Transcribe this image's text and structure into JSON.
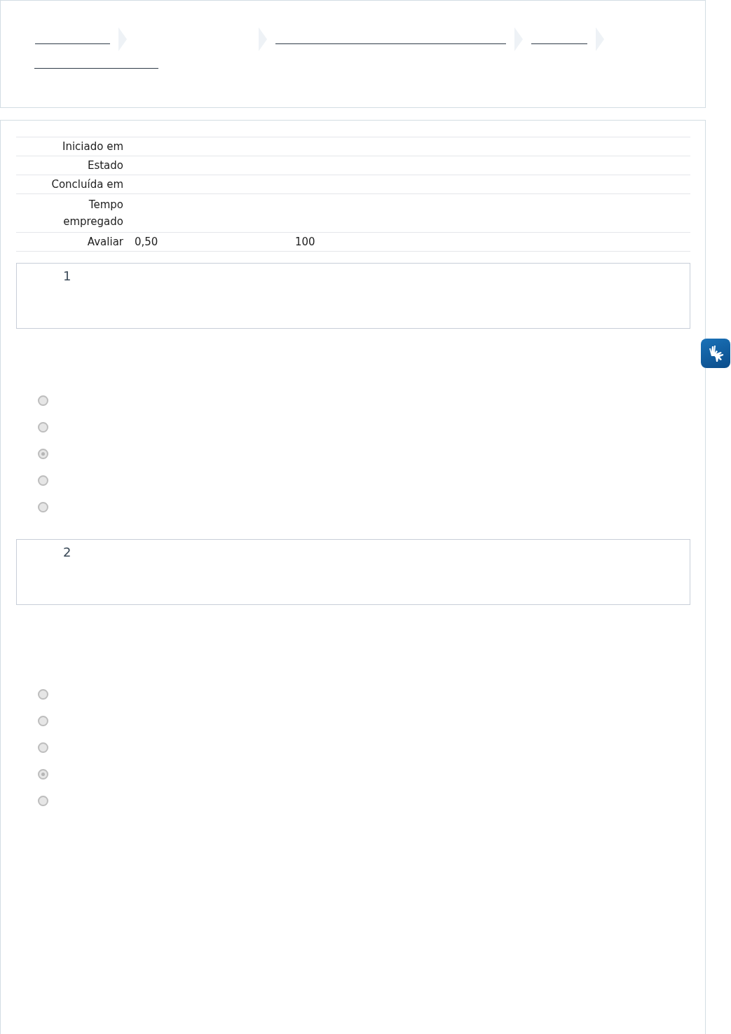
{
  "summary": {
    "rows": [
      {
        "label": "Iniciado em",
        "values": []
      },
      {
        "label": "Estado",
        "values": []
      },
      {
        "label": "Concluída em",
        "values": []
      },
      {
        "label": "Tempo empregado",
        "values": []
      },
      {
        "label": "Avaliar",
        "values": [
          "0,50",
          "100"
        ]
      }
    ]
  },
  "questions": [
    {
      "number": "1",
      "options": [
        {
          "selected": false
        },
        {
          "selected": false
        },
        {
          "selected": true
        },
        {
          "selected": false
        },
        {
          "selected": false
        }
      ]
    },
    {
      "number": "2",
      "options": [
        {
          "selected": false
        },
        {
          "selected": false
        },
        {
          "selected": false
        },
        {
          "selected": true
        },
        {
          "selected": false
        }
      ]
    }
  ]
}
